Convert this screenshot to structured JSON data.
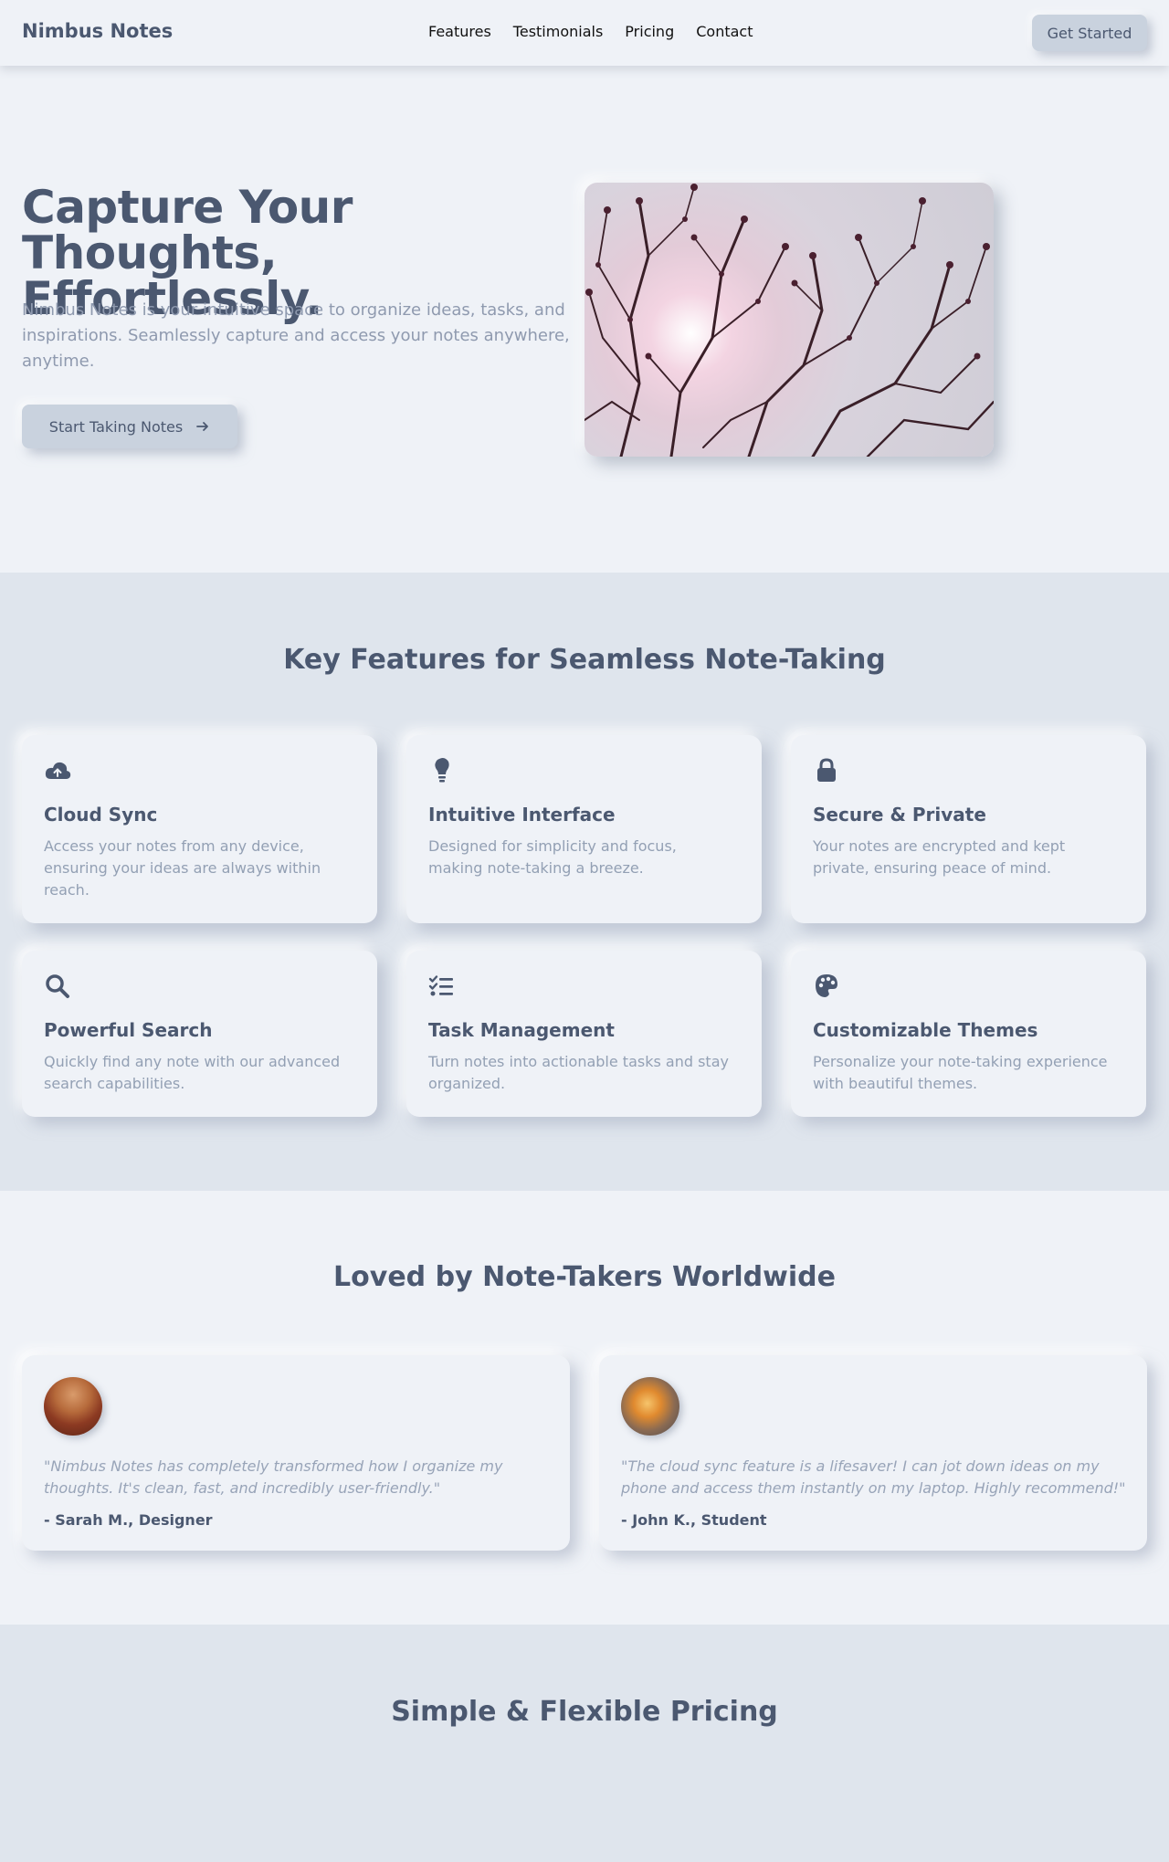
{
  "nav": {
    "brand": "Nimbus Notes",
    "links": [
      "Features",
      "Testimonials",
      "Pricing",
      "Contact"
    ],
    "cta": "Get Started"
  },
  "hero": {
    "title": "Capture Your Thoughts, Effortlessly.",
    "subtitle": "Nimbus Notes is your intuitive space to organize ideas, tasks, and inspirations. Seamlessly capture and access your notes anywhere, anytime.",
    "button": "Start Taking Notes",
    "button_icon": "arrow-right-icon",
    "image": "tree-branches-photo"
  },
  "features": {
    "title": "Key Features for Seamless Note-Taking",
    "items": [
      {
        "icon": "cloud-upload-icon",
        "title": "Cloud Sync",
        "desc": "Access your notes from any device, ensuring your ideas are always within reach."
      },
      {
        "icon": "lightbulb-icon",
        "title": "Intuitive Interface",
        "desc": "Designed for simplicity and focus, making note-taking a breeze."
      },
      {
        "icon": "lock-icon",
        "title": "Secure & Private",
        "desc": "Your notes are encrypted and kept private, ensuring peace of mind."
      },
      {
        "icon": "search-icon",
        "title": "Powerful Search",
        "desc": "Quickly find any note with our advanced search capabilities."
      },
      {
        "icon": "task-list-icon",
        "title": "Task Management",
        "desc": "Turn notes into actionable tasks and stay organized."
      },
      {
        "icon": "palette-icon",
        "title": "Customizable Themes",
        "desc": "Personalize your note-taking experience with beautiful themes."
      }
    ]
  },
  "testimonials": {
    "title": "Loved by Note-Takers Worldwide",
    "items": [
      {
        "quote": "\"Nimbus Notes has completely transformed how I organize my thoughts. It's clean, fast, and incredibly user-friendly.\"",
        "author": "- Sarah M., Designer"
      },
      {
        "quote": "\"The cloud sync feature is a lifesaver! I can jot down ideas on my phone and access them instantly on my laptop. Highly recommend!\"",
        "author": "- John K., Student"
      }
    ]
  },
  "pricing": {
    "title": "Simple & Flexible Pricing"
  },
  "colors": {
    "background": "#eff2f7",
    "section_alt": "#dfe5ed",
    "text_primary": "#4b5870",
    "text_muted": "#93a0b4",
    "button": "#c9d2de"
  }
}
